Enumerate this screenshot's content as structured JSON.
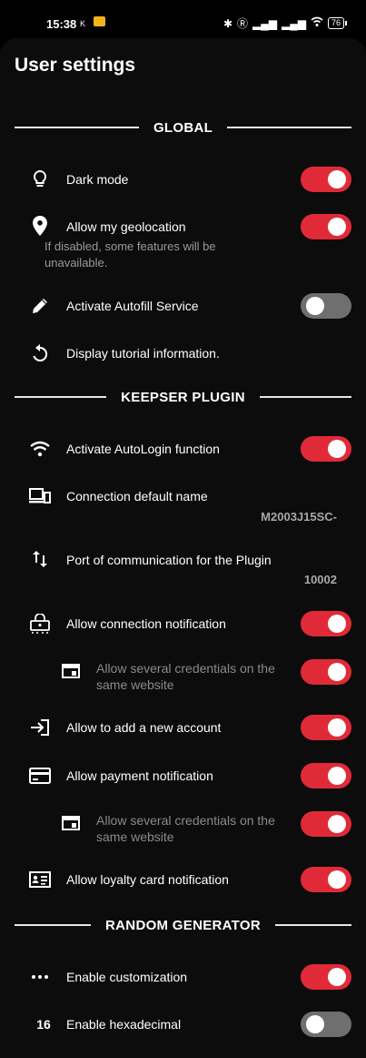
{
  "status_bar": {
    "time": "15:38",
    "k_glyph": "K",
    "battery": "76"
  },
  "page_title": "User settings",
  "sections": {
    "global": "GLOBAL",
    "keepser": "KEEPSER PLUGIN",
    "random": "RANDOM GENERATOR"
  },
  "items": {
    "dark_mode": {
      "label": "Dark mode",
      "state": "on",
      "icon": "lightbulb-icon"
    },
    "geolocation": {
      "label": "Allow my geolocation",
      "desc_line1": "If disabled, some features will be",
      "desc_line2": "unavailable.",
      "state": "on",
      "icon": "location-pin-icon"
    },
    "autofill": {
      "label": "Activate Autofill Service",
      "state": "off",
      "icon": "pencil-icon"
    },
    "tutorial": {
      "label": "Display tutorial information.",
      "icon": "restart-icon"
    },
    "autologin": {
      "label": "Activate AutoLogin function",
      "state": "on",
      "icon": "wifi-icon"
    },
    "connection_name": {
      "label": "Connection default name",
      "value": "M2003J15SC-",
      "icon": "devices-icon"
    },
    "port": {
      "label": "Port of communication for the Plugin",
      "value": "10002",
      "icon": "swap-arrows-icon"
    },
    "connection_notif": {
      "label": "Allow connection notification",
      "state": "on",
      "icon": "lock-icon"
    },
    "several_creds_1": {
      "line1": "Allow several credentials on the",
      "line2": "same website",
      "state": "on",
      "icon": "window-icon"
    },
    "add_account": {
      "label": "Allow to add a new account",
      "state": "on",
      "icon": "login-icon"
    },
    "payment_notif": {
      "label": "Allow payment notification",
      "state": "on",
      "icon": "credit-card-icon"
    },
    "several_creds_2": {
      "line1": "Allow several credentials on the",
      "line2": "same website",
      "state": "on",
      "icon": "window-icon"
    },
    "loyalty_notif": {
      "label": "Allow loyalty card notification",
      "state": "on",
      "icon": "id-card-icon"
    },
    "customization": {
      "label": "Enable customization",
      "state": "on",
      "icon": "more-dots-icon"
    },
    "hexadecimal": {
      "label": "Enable hexadecimal",
      "icon_text": "16",
      "state": "off"
    }
  },
  "colors": {
    "toggle_on": "#e12a38",
    "toggle_off": "#6f6f6f",
    "background": "#0c0c0c"
  }
}
